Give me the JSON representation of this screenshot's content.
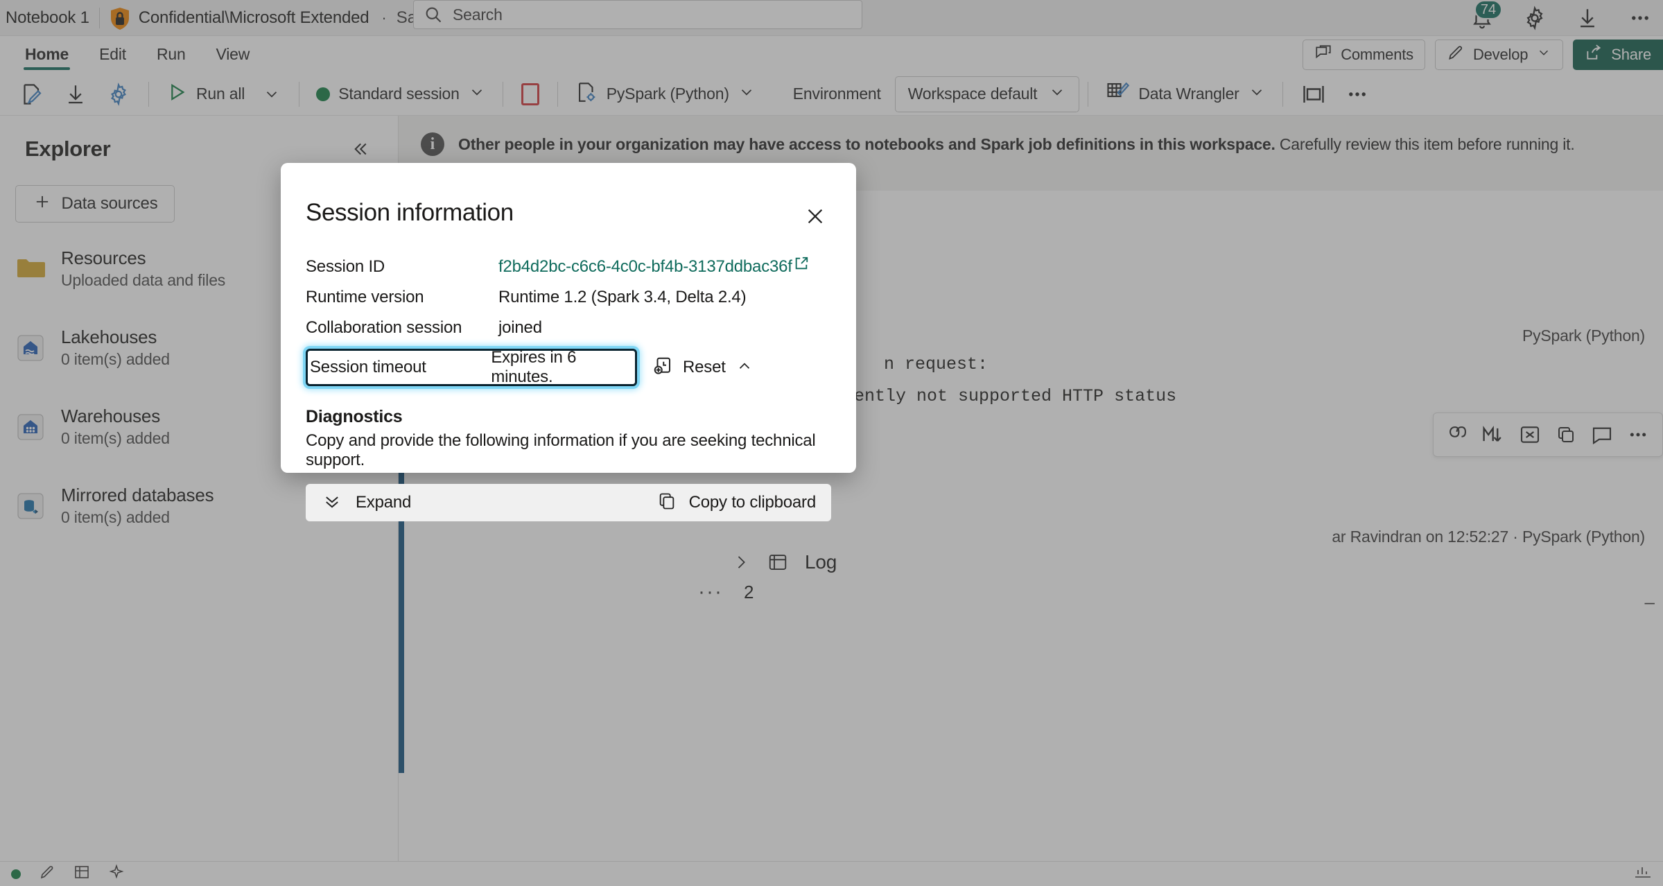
{
  "titlebar": {
    "notebook_name": "Notebook 1",
    "sensitivity_label": "Confidential\\Microsoft Extended",
    "separator_dot": "·",
    "save_state": "Saved",
    "search_placeholder": "Search",
    "notifications_count": "74"
  },
  "ribbon": {
    "tabs": [
      {
        "label": "Home",
        "active": true
      },
      {
        "label": "Edit",
        "active": false
      },
      {
        "label": "Run",
        "active": false
      },
      {
        "label": "View",
        "active": false
      }
    ],
    "comments_label": "Comments",
    "develop_label": "Develop",
    "share_label": "Share"
  },
  "commandbar": {
    "run_all_label": "Run all",
    "session_label": "Standard session",
    "language_label": "PySpark (Python)",
    "environment_label": "Environment",
    "workspace_default_label": "Workspace default",
    "data_wrangler_label": "Data Wrangler"
  },
  "sidebar": {
    "title": "Explorer",
    "add_data_sources_label": "Data sources",
    "items": [
      {
        "label": "Resources",
        "sub": "Uploaded data and files",
        "icon": "folder-icon"
      },
      {
        "label": "Lakehouses",
        "sub": "0 item(s) added",
        "icon": "lakehouse-icon"
      },
      {
        "label": "Warehouses",
        "sub": "0 item(s) added",
        "icon": "warehouse-icon"
      },
      {
        "label": "Mirrored databases",
        "sub": "0 item(s) added",
        "icon": "mirrored-database-icon"
      }
    ]
  },
  "content": {
    "info_bold": "Other people in your organization may have access to notebooks and Spark job definitions in this workspace.",
    "info_rest": " Carefully review this item before running it.",
    "cell_language": "PySpark (Python)",
    "code_line_1": "n request:",
    "code_line_2": "rently not supported HTTP status",
    "run_meta": "ar Ravindran on 12:52:27 ·  PySpark (Python)",
    "log_label": "Log",
    "cell_two_number": "2",
    "cell_two_dots": "···",
    "right_dash": "–"
  },
  "dialog": {
    "title": "Session information",
    "rows": [
      {
        "label": "Session ID",
        "value": "f2b4d2bc-c6c6-4c0c-bf4b-3137ddbac36f",
        "is_link": true
      },
      {
        "label": "Runtime version",
        "value": "Runtime 1.2 (Spark 3.4, Delta 2.4)",
        "is_link": false
      },
      {
        "label": "Collaboration session",
        "value": "joined",
        "is_link": false
      }
    ],
    "timeout_label": "Session timeout",
    "timeout_value": "Expires in 6 minutes.",
    "reset_label": "Reset",
    "diagnostics_title": "Diagnostics",
    "diagnostics_sub": "Copy and provide the following information if you are seeking technical support.",
    "expand_label": "Expand",
    "copy_label": "Copy to clipboard"
  },
  "colors": {
    "accent_green": "#0f6b5c",
    "share_green": "#0f5c4a",
    "focus_cyan": "#7fd6f5",
    "cell_bar_blue": "#12507f",
    "sensitivity_orange": "#ef8200"
  }
}
